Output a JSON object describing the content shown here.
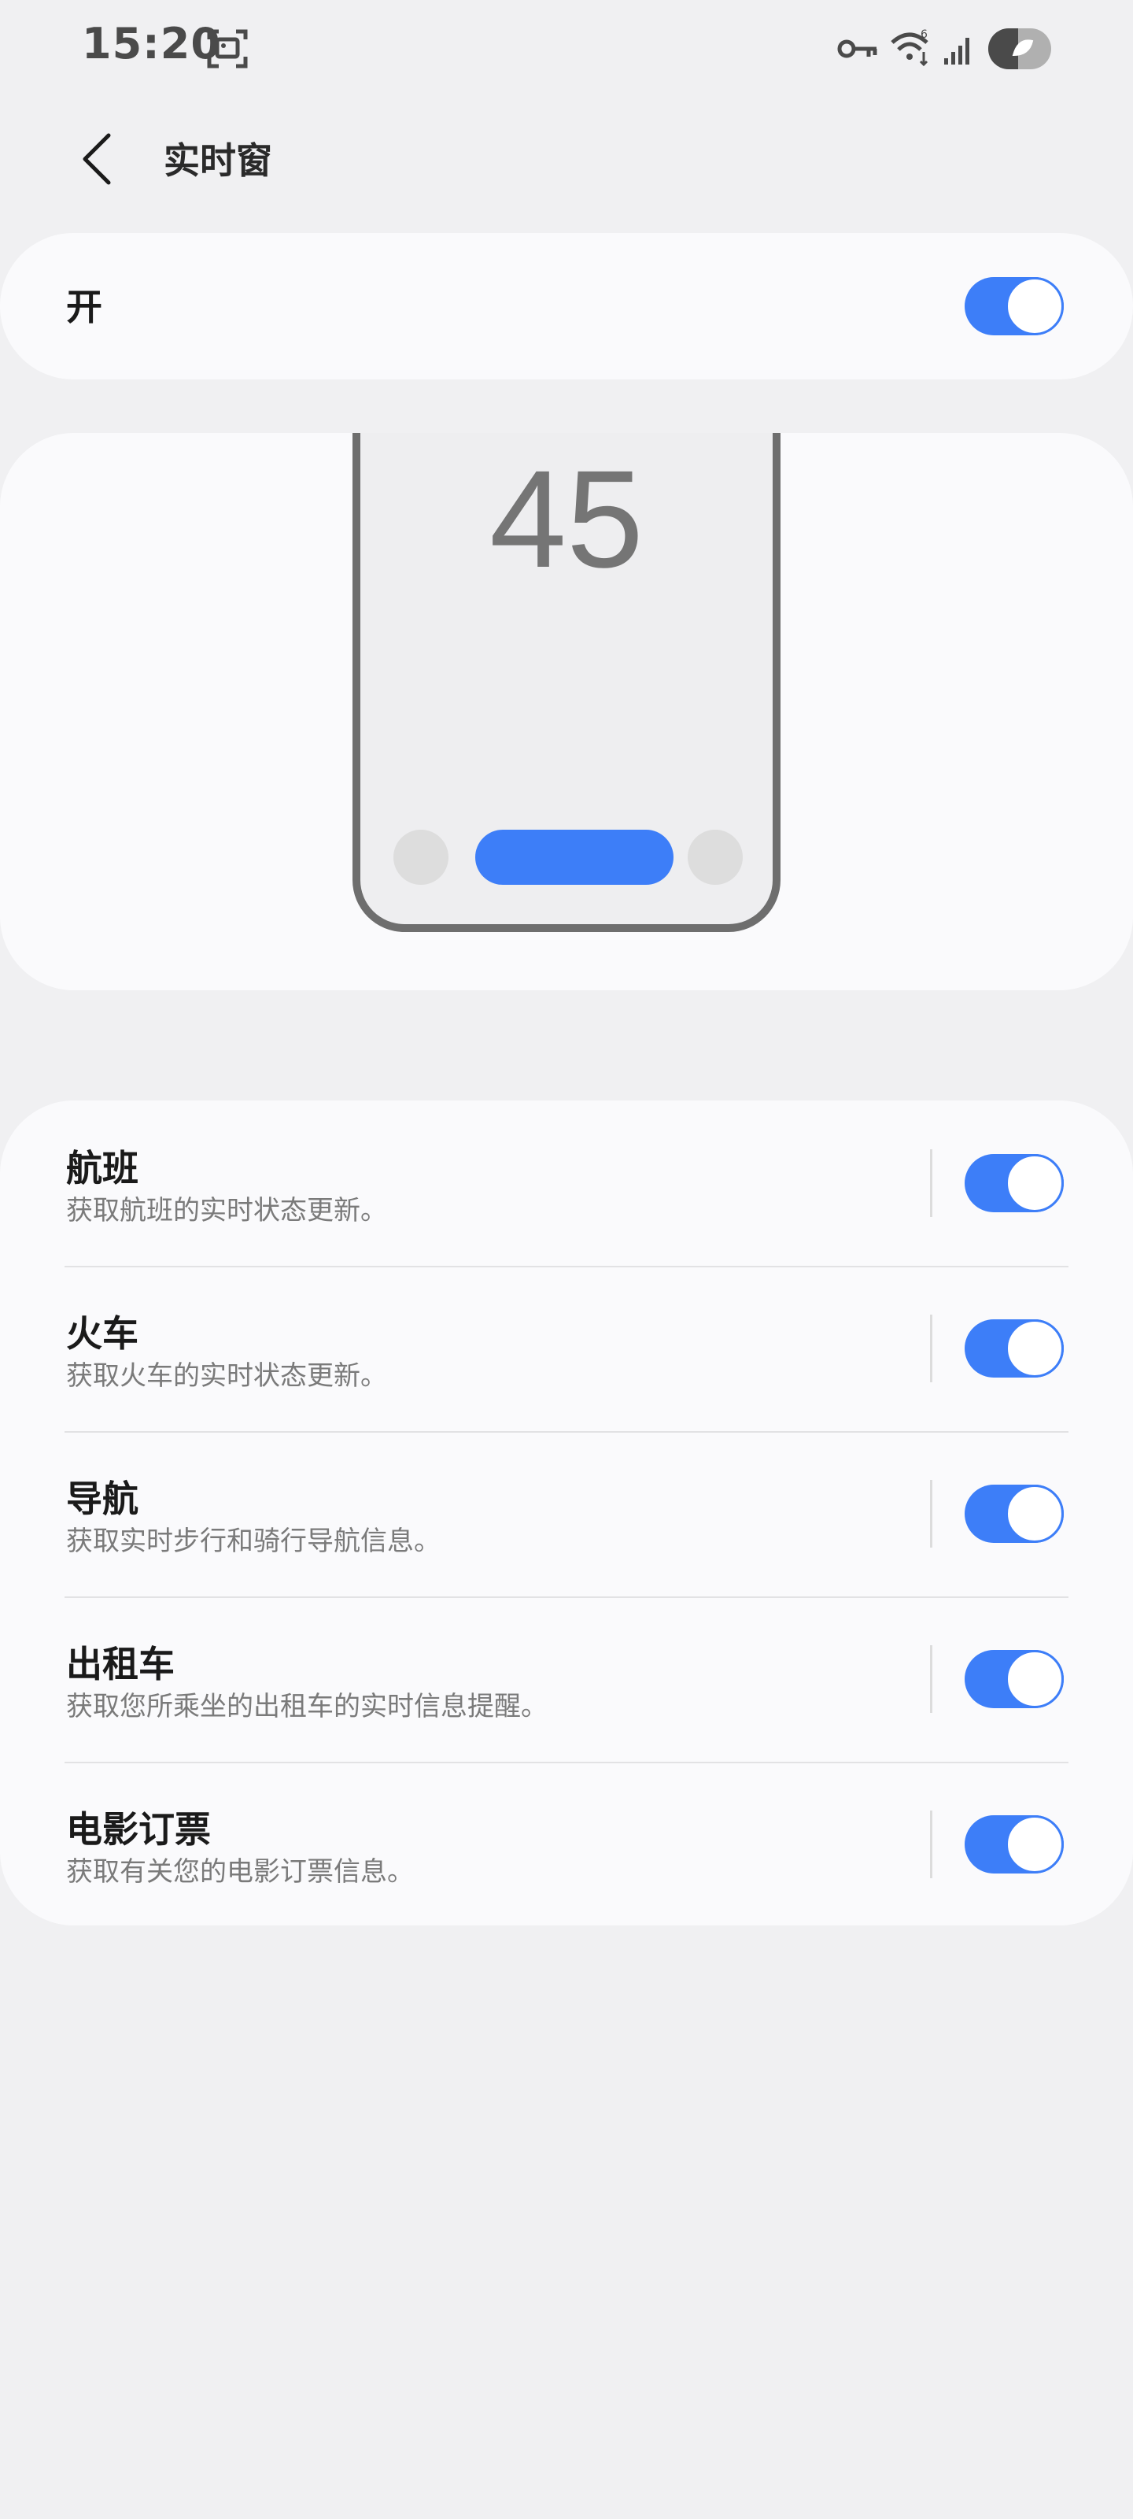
{
  "status_bar": {
    "time": "15:20",
    "icons": [
      "screenshot-icon",
      "key-icon",
      "wifi-icon",
      "signal-icon",
      "battery-saver-icon"
    ]
  },
  "header": {
    "title": "实时窗",
    "back_icon": "chevron-left-icon"
  },
  "master": {
    "label": "开",
    "enabled": true
  },
  "preview": {
    "number": "45"
  },
  "items": [
    {
      "title": "航班",
      "subtitle": "获取航班的实时状态更新。",
      "enabled": true
    },
    {
      "title": "火车",
      "subtitle": "获取火车的实时状态更新。",
      "enabled": true
    },
    {
      "title": "导航",
      "subtitle": "获取实时步行和骑行导航信息。",
      "enabled": true
    },
    {
      "title": "出租车",
      "subtitle": "获取您所乘坐的出租车的实时信息提醒。",
      "enabled": true
    },
    {
      "title": "电影订票",
      "subtitle": "获取有关您的电影订票信息。",
      "enabled": true
    }
  ],
  "colors": {
    "accent": "#3d7ef8",
    "background": "#f0f0f2",
    "card": "#fafafc"
  }
}
